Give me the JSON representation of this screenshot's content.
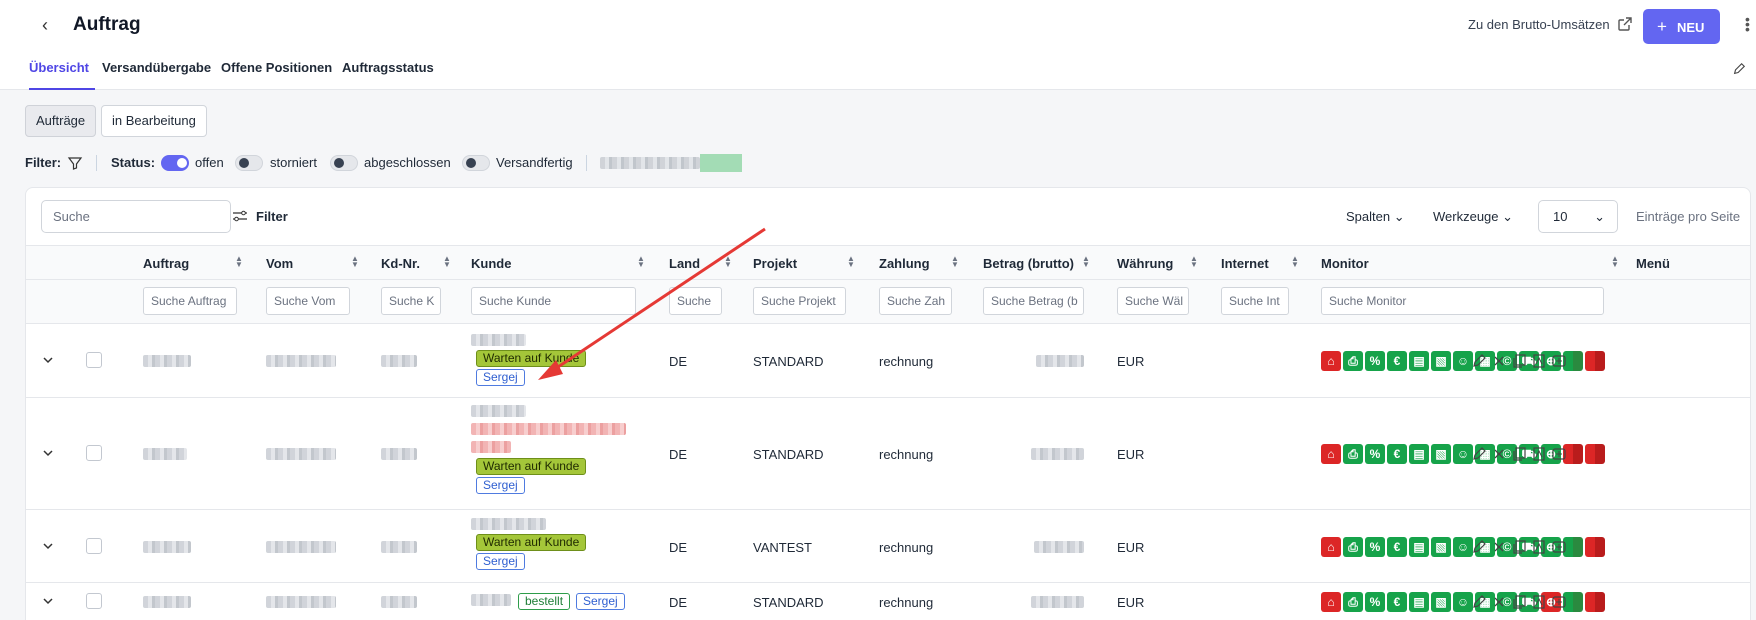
{
  "header": {
    "back_icon": "chevron-left-icon",
    "title": "Auftrag",
    "brutto_link": "Zu den Brutto-Umsätzen",
    "new_button": "NEU"
  },
  "tabs": [
    {
      "label": "Übersicht",
      "active": true
    },
    {
      "label": "Versandübergabe",
      "active": false
    },
    {
      "label": "Offene Positionen",
      "active": false
    },
    {
      "label": "Auftragsstatus",
      "active": false
    }
  ],
  "segments": [
    {
      "label": "Aufträge",
      "active": true
    },
    {
      "label": "in Bearbeitung",
      "active": false
    }
  ],
  "filters": {
    "filter_label": "Filter:",
    "status_label": "Status:",
    "toggles": [
      {
        "label": "offen",
        "on": true
      },
      {
        "label": "storniert",
        "on": false
      },
      {
        "label": "abgeschlossen",
        "on": false
      },
      {
        "label": "Versandfertig",
        "on": false
      }
    ]
  },
  "toolbar": {
    "search_placeholder": "Suche",
    "filter_button": "Filter",
    "columns_dropdown": "Spalten",
    "tools_dropdown": "Werkzeuge",
    "per_page_value": "10",
    "per_page_label": "Einträge pro Seite"
  },
  "table": {
    "columns": [
      "Auftrag",
      "Vom",
      "Kd-Nr.",
      "Kunde",
      "Land",
      "Projekt",
      "Zahlung",
      "Betrag (brutto)",
      "Währung",
      "Internet",
      "Monitor",
      "Menü"
    ],
    "filter_placeholders": [
      "Suche Auftrag",
      "Suche Vom",
      "Suche K",
      "Suche Kunde",
      "Suche",
      "Suche Projekt",
      "Suche Zah",
      "Suche Betrag (b",
      "Suche Wäl",
      "Suche Int",
      "Suche Monitor"
    ],
    "rows": [
      {
        "land": "DE",
        "projekt": "STANDARD",
        "zahlung": "rechnung",
        "waehrung": "EUR",
        "badges": [
          "Warten auf Kunde",
          "Sergej"
        ]
      },
      {
        "land": "DE",
        "projekt": "STANDARD",
        "zahlung": "rechnung",
        "waehrung": "EUR",
        "badges": [
          "Warten auf Kunde",
          "Sergej"
        ]
      },
      {
        "land": "DE",
        "projekt": "VANTEST",
        "zahlung": "rechnung",
        "waehrung": "EUR",
        "badges": [
          "Warten auf Kunde",
          "Sergej"
        ]
      },
      {
        "land": "DE",
        "projekt": "STANDARD",
        "zahlung": "rechnung",
        "waehrung": "EUR",
        "badges": [
          "bestellt",
          "Sergej"
        ]
      }
    ]
  },
  "monitor_icons": [
    "home-icon",
    "printer-icon",
    "percent-icon",
    "euro-icon",
    "money-icon",
    "invoice-icon",
    "person-icon",
    "calendar-icon",
    "coin-icon",
    "truck-icon",
    "globe-icon"
  ],
  "colors": {
    "accent": "#6366f1",
    "status_green": "#16a34a",
    "status_red": "#dc2626",
    "badge_wait": "#a4c639",
    "arrow": "#e53935"
  }
}
